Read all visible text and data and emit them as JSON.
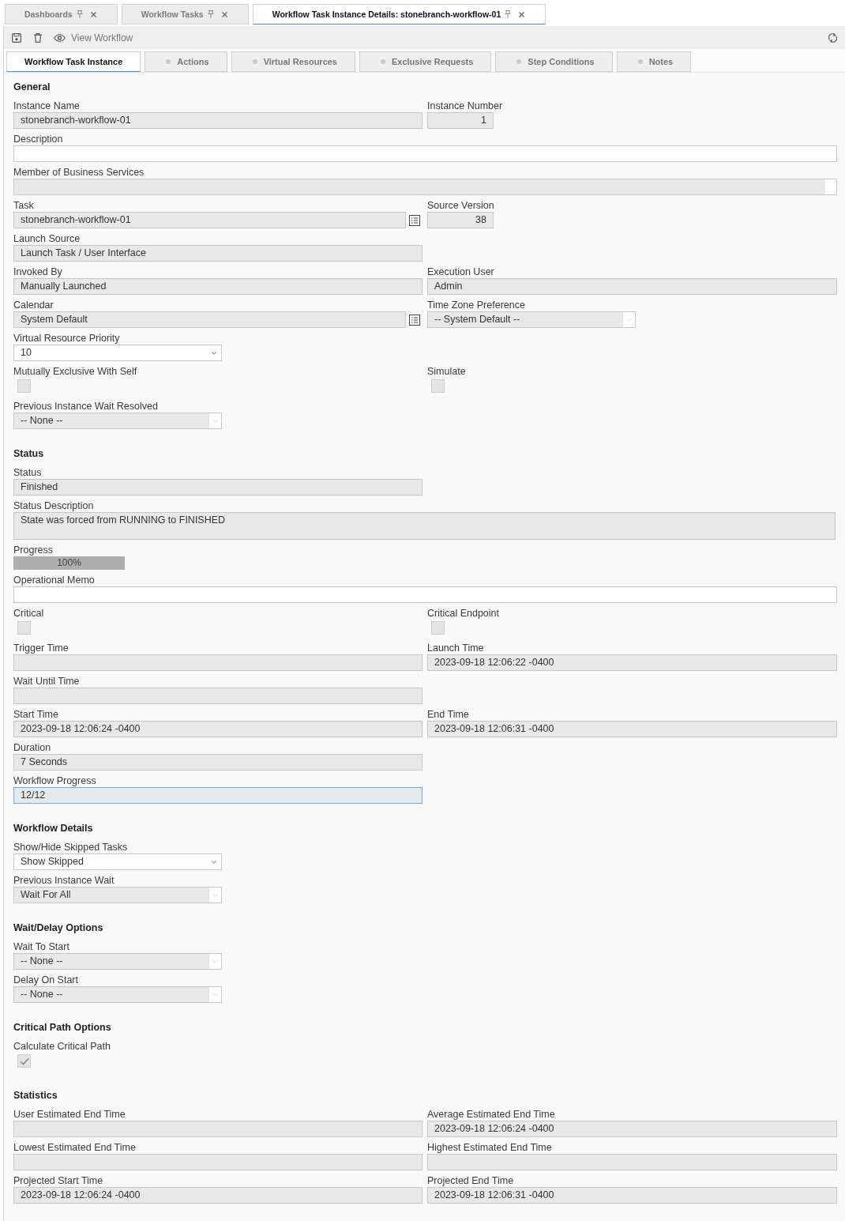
{
  "doc_tabs": [
    {
      "label": "Dashboards",
      "selected": false
    },
    {
      "label": "Workflow Tasks",
      "selected": false
    },
    {
      "label": "Workflow Task Instance Details: stonebranch-workflow-01",
      "selected": true
    }
  ],
  "toolbar": {
    "view_button": "View Workflow"
  },
  "tabs": [
    {
      "label": "Workflow Task Instance",
      "selected": true
    },
    {
      "label": "Actions",
      "selected": false
    },
    {
      "label": "Virtual Resources",
      "selected": false
    },
    {
      "label": "Exclusive Requests",
      "selected": false
    },
    {
      "label": "Step Conditions",
      "selected": false
    },
    {
      "label": "Notes",
      "selected": false
    }
  ],
  "sections": [
    {
      "title": "General",
      "rows": [
        [
          {
            "label": "Instance Name",
            "kind": "text",
            "value": "stonebranch-workflow-01",
            "disabled": true,
            "focused": false
          },
          {
            "label": "Instance Number",
            "kind": "number",
            "value": "1",
            "disabled": true,
            "focused": false
          }
        ],
        [
          {
            "label": "Description",
            "kind": "wide",
            "disabled": false,
            "focused": false
          }
        ],
        [
          {
            "label": "Member of Business Services",
            "kind": "multiselect",
            "disabled": true,
            "focused": false
          }
        ],
        [
          {
            "label": "Task",
            "kind": "lookup",
            "value": "stonebranch-workflow-01",
            "disabled": true,
            "focused": false
          },
          {
            "label": "Source Version",
            "kind": "number",
            "value": "38",
            "disabled": true,
            "focused": false
          }
        ],
        [
          {
            "label": "Launch Source",
            "kind": "text",
            "value": "Launch Task / User Interface",
            "disabled": true,
            "focused": false
          }
        ],
        [
          {
            "label": "Invoked By",
            "kind": "text",
            "value": "Manually Launched",
            "disabled": true,
            "focused": false
          },
          {
            "label": "Execution User",
            "kind": "text",
            "value": "Admin",
            "disabled": true,
            "focused": false
          }
        ],
        [
          {
            "label": "Calendar",
            "kind": "lookup",
            "value": "System Default",
            "disabled": true,
            "focused": false
          },
          {
            "label": "Time Zone Preference",
            "kind": "select",
            "value": "-- System Default --",
            "disabled": true,
            "focused": false
          }
        ],
        [
          {
            "label": "Virtual Resource Priority",
            "kind": "select",
            "value": "10",
            "disabled": false,
            "focused": false
          }
        ],
        [
          {
            "label": "Mutually Exclusive With Self",
            "kind": "checkbox",
            "checked": false,
            "disabled": true
          },
          {
            "label": "Simulate",
            "kind": "checkbox",
            "checked": false,
            "disabled": true
          }
        ],
        [
          {
            "label": "Previous Instance Wait Resolved",
            "kind": "select",
            "value": "-- None --",
            "disabled": true,
            "focused": false
          }
        ]
      ]
    },
    {
      "title": "Status",
      "rows": [
        [
          {
            "label": "Status",
            "kind": "text",
            "value": "Finished",
            "disabled": true,
            "focused": false
          }
        ],
        [
          {
            "label": "Status Description",
            "kind": "textarea",
            "value": "State was forced from RUNNING to FINISHED",
            "disabled": true,
            "focused": false
          }
        ],
        [
          {
            "label": "Progress",
            "kind": "progress",
            "level": 1,
            "reading": "100%"
          }
        ],
        [
          {
            "label": "Operational Memo",
            "kind": "wide",
            "disabled": false,
            "focused": false
          }
        ],
        [
          {
            "label": "Critical",
            "kind": "checkbox",
            "checked": false,
            "disabled": true
          },
          {
            "label": "Critical Endpoint",
            "kind": "checkbox",
            "checked": false,
            "disabled": true
          }
        ],
        [
          {
            "label": "Trigger Time",
            "kind": "text",
            "disabled": true,
            "focused": false
          },
          {
            "label": "Launch Time",
            "kind": "text",
            "value": "2023-09-18 12:06:22 -0400",
            "disabled": true,
            "focused": false
          }
        ],
        [
          {
            "label": "Wait Until Time",
            "kind": "text",
            "disabled": true,
            "focused": false
          }
        ],
        [
          {
            "label": "Start Time",
            "kind": "text",
            "value": "2023-09-18 12:06:24 -0400",
            "disabled": true,
            "focused": false
          },
          {
            "label": "End Time",
            "kind": "text",
            "value": "2023-09-18 12:06:31 -0400",
            "disabled": true,
            "focused": false
          }
        ],
        [
          {
            "label": "Duration",
            "kind": "text",
            "value": "7 Seconds",
            "disabled": true,
            "focused": false
          }
        ],
        [
          {
            "label": "Workflow Progress",
            "kind": "text",
            "value": "12/12",
            "disabled": true,
            "focused": true
          }
        ]
      ]
    },
    {
      "title": "Workflow Details",
      "rows": [
        [
          {
            "label": "Show/Hide Skipped Tasks",
            "kind": "select",
            "value": "Show Skipped",
            "disabled": false,
            "focused": false
          }
        ],
        [
          {
            "label": "Previous Instance Wait",
            "kind": "select",
            "value": "Wait For All",
            "disabled": true,
            "focused": false
          }
        ]
      ]
    },
    {
      "title": "Wait/Delay Options",
      "rows": [
        [
          {
            "label": "Wait To Start",
            "kind": "select",
            "value": "-- None --",
            "disabled": true,
            "focused": false
          }
        ],
        [
          {
            "label": "Delay On Start",
            "kind": "select",
            "value": "-- None --",
            "disabled": true,
            "focused": false
          }
        ]
      ]
    },
    {
      "title": "Critical Path Options",
      "rows": [
        [
          {
            "label": "Calculate Critical Path",
            "kind": "checkbox",
            "checked": true,
            "disabled": true
          }
        ]
      ]
    },
    {
      "title": "Statistics",
      "rows": [
        [
          {
            "label": "User Estimated End Time",
            "kind": "text",
            "disabled": true,
            "focused": false
          },
          {
            "label": "Average Estimated End Time",
            "kind": "text",
            "value": "2023-09-18 12:06:24 -0400",
            "disabled": true,
            "focused": false
          }
        ],
        [
          {
            "label": "Lowest Estimated End Time",
            "kind": "text",
            "disabled": true,
            "focused": false
          },
          {
            "label": "Highest Estimated End Time",
            "kind": "text",
            "disabled": true,
            "focused": false
          }
        ],
        [
          {
            "label": "Projected Start Time",
            "kind": "text",
            "value": "2023-09-18 12:06:24 -0400",
            "disabled": true,
            "focused": false
          },
          {
            "label": "Projected End Time",
            "kind": "text",
            "value": "2023-09-18 12:06:31 -0400",
            "disabled": true,
            "focused": false
          }
        ]
      ]
    }
  ]
}
